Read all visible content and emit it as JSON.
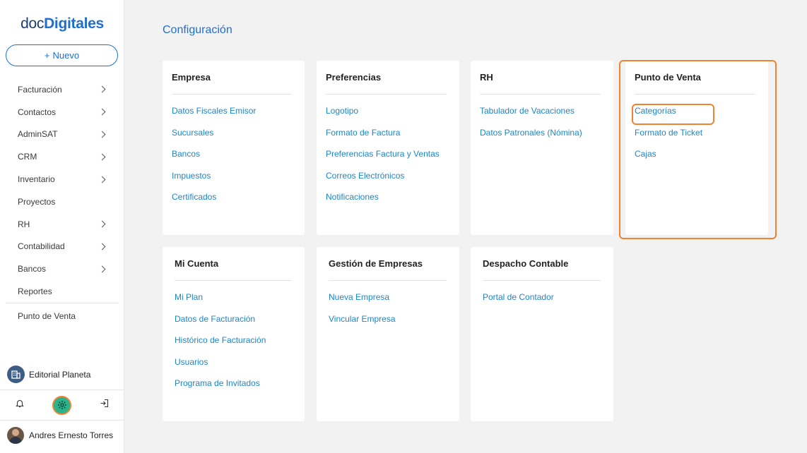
{
  "logo": {
    "light": "doc",
    "bold": "Digitales"
  },
  "new_button": {
    "label": "Nuevo",
    "plus": "+"
  },
  "nav": [
    {
      "label": "Facturación",
      "has_chevron": true
    },
    {
      "label": "Contactos",
      "has_chevron": true
    },
    {
      "label": "AdminSAT",
      "has_chevron": true
    },
    {
      "label": "CRM",
      "has_chevron": true
    },
    {
      "label": "Inventario",
      "has_chevron": true
    },
    {
      "label": "Proyectos",
      "has_chevron": false
    },
    {
      "label": "RH",
      "has_chevron": true
    },
    {
      "label": "Contabilidad",
      "has_chevron": true
    },
    {
      "label": "Bancos",
      "has_chevron": true
    },
    {
      "label": "Reportes",
      "has_chevron": false
    },
    {
      "label": "Punto de Venta",
      "has_chevron": false
    }
  ],
  "company": {
    "name": "Editorial Planeta"
  },
  "footer_icons": [
    "bell-icon",
    "gear-icon",
    "logout-icon"
  ],
  "user": {
    "name": "Andres Ernesto Torres"
  },
  "page_title": "Configuración",
  "cards": [
    {
      "title": "Empresa",
      "links": [
        "Datos Fiscales Emisor",
        "Sucursales",
        "Bancos",
        "Impuestos",
        "Certificados"
      ]
    },
    {
      "title": "Preferencias",
      "links": [
        "Logotipo",
        "Formato de Factura",
        "Preferencias Factura y Ventas",
        "Correos Electrónicos",
        "Notificaciones"
      ]
    },
    {
      "title": "RH",
      "links": [
        "Tabulador de Vacaciones",
        "Datos Patronales (Nómina)"
      ]
    },
    {
      "title": "Punto de Venta",
      "links": [
        "Categorías",
        "Formato de Ticket",
        "Cajas"
      ]
    },
    {
      "title": "Mi Cuenta",
      "links": [
        "Mi Plan",
        "Datos de Facturación",
        "Histórico de Facturación",
        "Usuarios",
        "Programa de Invitados"
      ]
    },
    {
      "title": "Gestión de Empresas",
      "links": [
        "Nueva Empresa",
        "Vincular Empresa"
      ]
    },
    {
      "title": "Despacho Contable",
      "links": [
        "Portal de Contador"
      ]
    }
  ],
  "colors": {
    "accent": "#1f6fd1",
    "link": "#1d86c7",
    "highlight": "#f0832f",
    "settings_active": "#2bb38b"
  }
}
